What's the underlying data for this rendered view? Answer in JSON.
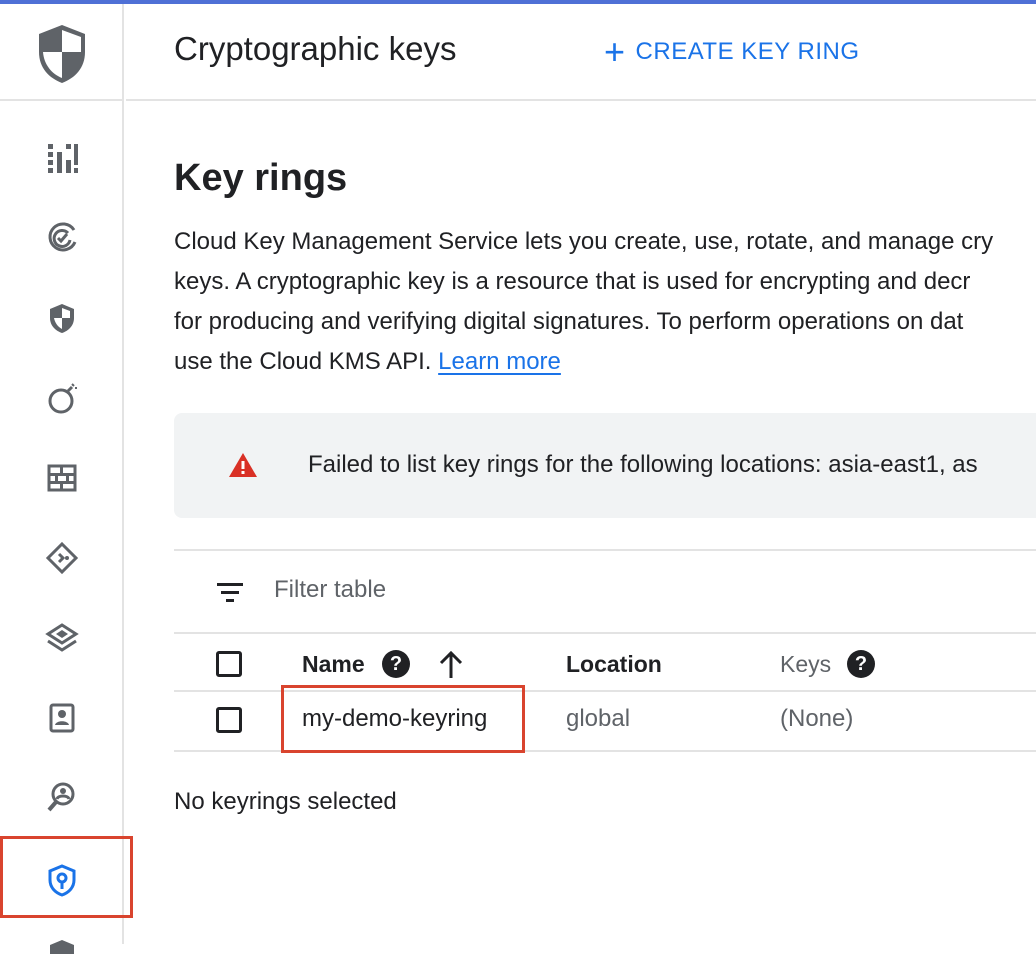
{
  "header": {
    "title": "Cryptographic keys",
    "create_button": "CREATE KEY RING"
  },
  "sidebar": {
    "items": [
      {
        "icon": "dashboard-icon"
      },
      {
        "icon": "compliance-icon"
      },
      {
        "icon": "shield-icon"
      },
      {
        "icon": "bomb-icon"
      },
      {
        "icon": "firewall-icon"
      },
      {
        "icon": "diamond-nav-icon"
      },
      {
        "icon": "layers-icon"
      },
      {
        "icon": "id-card-icon"
      },
      {
        "icon": "search-person-icon"
      },
      {
        "icon": "key-shield-icon",
        "active": true
      }
    ]
  },
  "main": {
    "section_title": "Key rings",
    "description_lines": [
      "Cloud Key Management Service lets you create, use, rotate, and manage cry",
      "keys. A cryptographic key is a resource that is used for encrypting and decr",
      "for producing and verifying digital signatures. To perform operations on dat",
      "use the Cloud KMS API."
    ],
    "learn_more": "Learn more",
    "alert_text": "Failed to list key rings for the following locations: asia-east1, as",
    "filter_placeholder": "Filter table",
    "table": {
      "columns": [
        "Name",
        "Location",
        "Keys"
      ],
      "rows": [
        {
          "name": "my-demo-keyring",
          "location": "global",
          "keys": "(None)"
        }
      ]
    },
    "selection_status": "No keyrings selected"
  },
  "colors": {
    "accent": "#1a73e8",
    "highlight": "#d9442e",
    "warning": "#d93025"
  }
}
